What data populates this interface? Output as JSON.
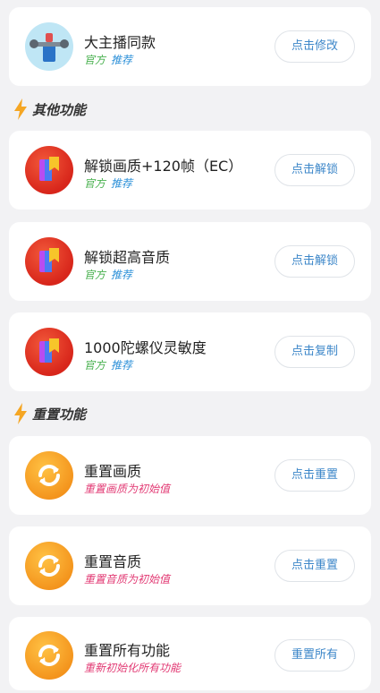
{
  "top_card": {
    "title": "大主播同款",
    "tag_official": "官方",
    "tag_recommend": "推荐",
    "button": "点击修改"
  },
  "sections": {
    "other": {
      "label": "其他功能",
      "icon": "lightning-bolt-icon"
    },
    "reset": {
      "label": "重置功能",
      "icon": "lightning-bolt-icon"
    }
  },
  "other_items": [
    {
      "title": "解锁画质+120帧（EC）",
      "tag_official": "官方",
      "tag_recommend": "推荐",
      "button": "点击解锁"
    },
    {
      "title": "解锁超高音质",
      "tag_official": "官方",
      "tag_recommend": "推荐",
      "button": "点击解锁"
    },
    {
      "title": "1000陀螺仪灵敏度",
      "tag_official": "官方",
      "tag_recommend": "推荐",
      "button": "点击复制"
    }
  ],
  "reset_items": [
    {
      "title": "重置画质",
      "subtitle": "重置画质为初始值",
      "button": "点击重置"
    },
    {
      "title": "重置音质",
      "subtitle": "重置音质为初始值",
      "button": "点击重置"
    },
    {
      "title": "重置所有功能",
      "subtitle": "重新初始化所有功能",
      "button": "重置所有"
    }
  ],
  "colors": {
    "background": "#f2f2f4",
    "tag_official": "#47b04d",
    "tag_recommend": "#2a8fd8",
    "tag_reset": "#e23a74",
    "button_text": "#3d87c9",
    "bolt": "#f5a623"
  }
}
